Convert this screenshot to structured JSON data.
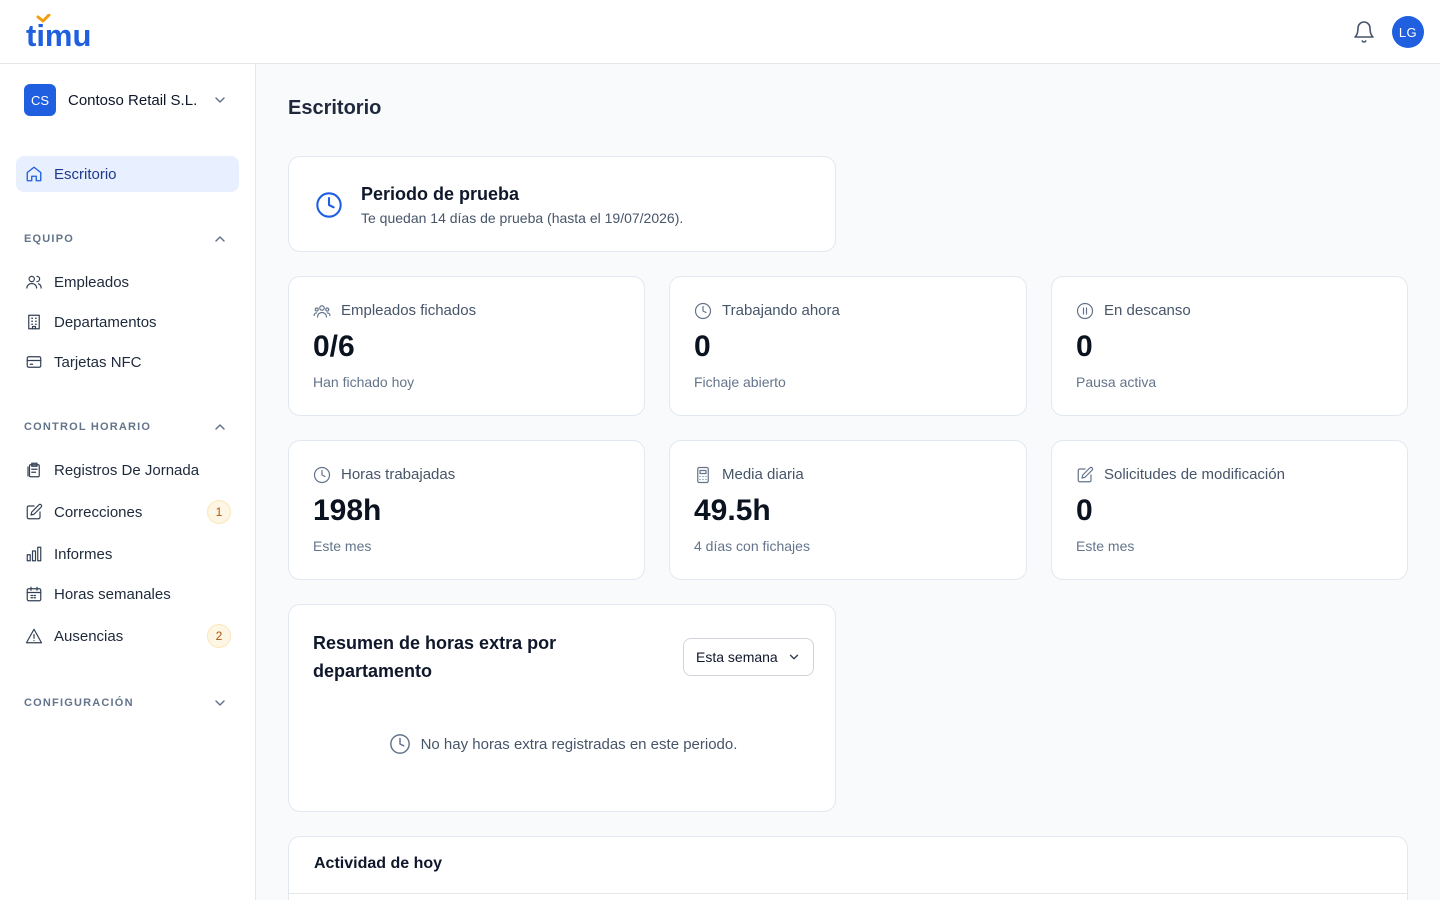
{
  "app": {
    "logo_text": "timu",
    "user_initials": "LG"
  },
  "sidebar": {
    "org": {
      "initials": "CS",
      "name": "Contoso Retail S.L."
    },
    "home": {
      "label": "Escritorio"
    },
    "sections": [
      {
        "title": "EQUIPO",
        "items": [
          {
            "label": "Empleados",
            "icon": "users-icon"
          },
          {
            "label": "Departamentos",
            "icon": "building-icon"
          },
          {
            "label": "Tarjetas NFC",
            "icon": "card-icon"
          }
        ]
      },
      {
        "title": "CONTROL HORARIO",
        "items": [
          {
            "label": "Registros De Jornada",
            "icon": "clipboard-icon"
          },
          {
            "label": "Correcciones",
            "icon": "edit-icon",
            "badge": "1"
          },
          {
            "label": "Informes",
            "icon": "bar-chart-icon"
          },
          {
            "label": "Horas semanales",
            "icon": "calendar-icon"
          },
          {
            "label": "Ausencias",
            "icon": "warning-icon",
            "badge": "2"
          }
        ]
      },
      {
        "title": "CONFIGURACIÓN",
        "items": []
      }
    ]
  },
  "main": {
    "title": "Escritorio",
    "trial": {
      "title": "Periodo de prueba",
      "subtitle": "Te quedan 14 días de prueba (hasta el 19/07/2026)."
    },
    "stats": [
      {
        "label": "Empleados fichados",
        "value": "0/6",
        "sub": "Han fichado hoy",
        "icon": "users-icon"
      },
      {
        "label": "Trabajando ahora",
        "value": "0",
        "sub": "Fichaje abierto",
        "icon": "clock-icon"
      },
      {
        "label": "En descanso",
        "value": "0",
        "sub": "Pausa activa",
        "icon": "pause-icon"
      },
      {
        "label": "Horas trabajadas",
        "value": "198h",
        "sub": "Este mes",
        "icon": "clock-icon"
      },
      {
        "label": "Media diaria",
        "value": "49.5h",
        "sub": "4 días con fichajes",
        "icon": "calculator-icon"
      },
      {
        "label": "Solicitudes de modificación",
        "value": "0",
        "sub": "Este mes",
        "icon": "edit-icon"
      }
    ],
    "overtime": {
      "title": "Resumen de horas extra por departamento",
      "period": "Esta semana",
      "empty": "No hay horas extra registradas en este periodo."
    },
    "activity": {
      "title": "Actividad de hoy"
    }
  },
  "colors": {
    "accent": "#1f5fe0",
    "logo_accent": "#f59e0b",
    "badge_bg": "#fef6e4",
    "active_bg": "#e8efff"
  }
}
